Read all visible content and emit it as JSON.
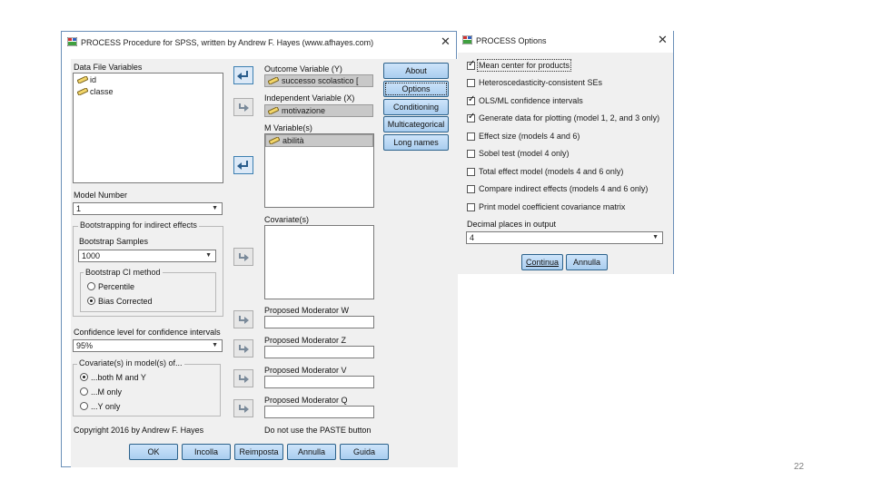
{
  "process_dialog": {
    "title": "PROCESS Procedure for SPSS, written by Andrew F. Hayes (www.afhayes.com)",
    "close_glyph": "✕",
    "data_file_variables_label": "Data File Variables",
    "variables": [
      "id",
      "classe"
    ],
    "outcome_label": "Outcome Variable (Y)",
    "outcome_value": "successo scolastico [",
    "independent_label": "Independent Variable (X)",
    "independent_value": "motivazione",
    "mvar_label": "M Variable(s)",
    "mvar_value": "abilità",
    "covariates_label": "Covariate(s)",
    "side_buttons": [
      "About",
      "Options",
      "Conditioning",
      "Multicategorical",
      "Long names"
    ],
    "model_number_label": "Model Number",
    "model_number_value": "1",
    "bootstrap_group": "Bootstrapping for indirect effects",
    "bootstrap_samples_label": "Bootstrap Samples",
    "bootstrap_samples_value": "1000",
    "ci_method_group": "Bootstrap CI method",
    "ci_methods": [
      "Percentile",
      "Bias Corrected"
    ],
    "confidence_label": "Confidence level for confidence intervals",
    "confidence_value": "95%",
    "covariates_in_group": "Covariate(s) in model(s) of...",
    "covariates_in_options": [
      "...both M and Y",
      "...M only",
      "...Y only"
    ],
    "moderator_w_label": "Proposed Moderator W",
    "moderator_z_label": "Proposed Moderator Z",
    "moderator_v_label": "Proposed Moderator V",
    "moderator_q_label": "Proposed Moderator Q",
    "copyright": "Copyright 2016 by Andrew F. Hayes",
    "paste_note": "Do not use the PASTE button",
    "bottom_buttons": [
      "OK",
      "Incolla",
      "Reimposta",
      "Annulla",
      "Guida"
    ]
  },
  "options_dialog": {
    "title": "PROCESS Options",
    "close_glyph": "✕",
    "checkboxes": [
      {
        "label": "Mean center for products",
        "checked": true
      },
      {
        "label": "Heteroscedasticity-consistent SEs",
        "checked": false
      },
      {
        "label": "OLS/ML confidence intervals",
        "checked": true
      },
      {
        "label": "Generate data for plotting (model 1, 2, and 3 only)",
        "checked": true
      },
      {
        "label": "Effect size (models 4 and 6)",
        "checked": false
      },
      {
        "label": "Sobel test (model 4 only)",
        "checked": false
      },
      {
        "label": "Total effect model (models 4 and 6 only)",
        "checked": false
      },
      {
        "label": "Compare indirect effects (models 4 and 6 only)",
        "checked": false
      },
      {
        "label": "Print model coefficient covariance matrix",
        "checked": false
      }
    ],
    "decimal_label": "Decimal places in output",
    "decimal_value": "4",
    "buttons": [
      "Continua",
      "Annulla"
    ]
  },
  "slide": {
    "page_number": "22"
  },
  "colors": {
    "accent_button": "#a9cdef",
    "slot_fill": "#c8c8c8",
    "client_bg": "#f0f0f0"
  },
  "icons": [
    "spss-window-icon",
    "ruler-variable-icon",
    "arrow-right-icon",
    "arrow-return-icon",
    "dropdown-chevron-icon"
  ]
}
